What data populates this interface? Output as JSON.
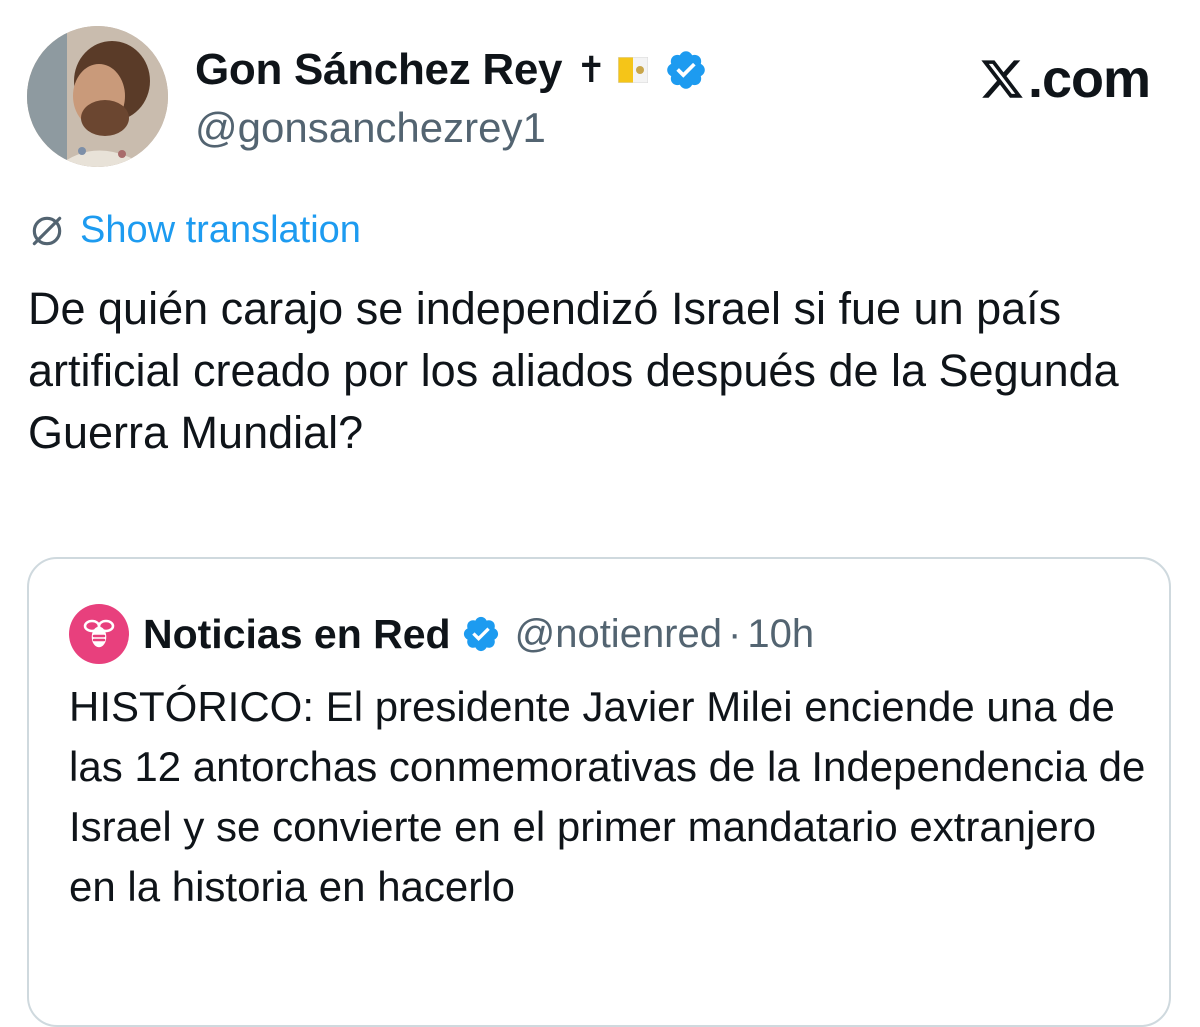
{
  "author": {
    "display_name": "Gon Sánchez Rey",
    "name_emoji_1": "✝",
    "flag_emoji_name": "vatican-flag",
    "handle": "@gonsanchezrey1",
    "verified": true
  },
  "branding": {
    "site_label": ".com"
  },
  "translate": {
    "label": "Show translation"
  },
  "tweet": {
    "text": "De quién carajo se independizó Israel si fue un país artificial creado por los aliados después de la Segunda Guerra Mundial?"
  },
  "quoted_tweet": {
    "display_name": "Noticias en Red",
    "handle": "@notienred",
    "separator": "·",
    "time": "10h",
    "verified": true,
    "text": "HISTÓRICO: El presidente Javier Milei enciende una de las 12 antorchas conmemorativas de la Independencia de Israel y se convierte en el primer mandatario extranjero en la historia en hacerlo"
  },
  "colors": {
    "link": "#1d9bf0",
    "verified": "#1d9bf0",
    "muted_text": "#536471",
    "border": "#cfd9de",
    "quote_avatar": "#e8407d"
  }
}
